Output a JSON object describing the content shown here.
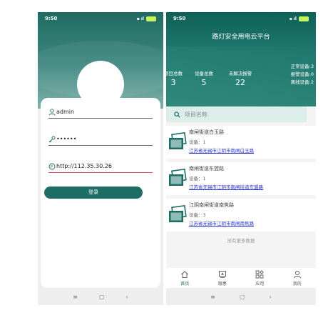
{
  "login": {
    "status": {
      "time": "9:50",
      "signal": "☰ ᵢₗₗ",
      "battery": "■"
    },
    "fields": {
      "username": "admin",
      "password": "••••••",
      "server": "http://112.35.30.26"
    },
    "login_button": "登录",
    "nav": {
      "menu": "≡",
      "home": "▢",
      "back": "‹"
    }
  },
  "app": {
    "status": {
      "time": "9:50",
      "signal": "☰ ᵢₗₗ",
      "battery": "■"
    },
    "title": "路灯安全用电云平台",
    "stats": [
      {
        "label": "项目总数",
        "value": "3"
      },
      {
        "label": "设备总数",
        "value": "5"
      },
      {
        "label": "未解决报警",
        "value": "22"
      }
    ],
    "side_stats": [
      "正常设备:3",
      "报警设备:0",
      "离线设备:2"
    ],
    "search_placeholder": "项目名称",
    "projects": [
      {
        "name": "南闸街道白玉路",
        "count": "设备：1",
        "address": "江苏省无锡市江阴市南闸白玉路"
      },
      {
        "name": "南闸街道东盟路",
        "count": "设备：1",
        "address": "江苏省无锡市江阴市南闸街道东盟路"
      },
      {
        "name": "江阴南闸街道南焦路",
        "count": "设备：3",
        "address": "江苏省无锡市江阴市南闸南焦路"
      }
    ],
    "no_more": "没有更多数据",
    "tabs": [
      {
        "label": "首页",
        "icon": "home-icon"
      },
      {
        "label": "隐患",
        "icon": "monitor-icon"
      },
      {
        "label": "应用",
        "icon": "apps-icon"
      },
      {
        "label": "我的",
        "icon": "user-icon"
      }
    ],
    "nav": {
      "menu": "≡",
      "home": "▢",
      "back": "‹"
    },
    "accent": "#1d6d64",
    "link_color": "#2b36c9"
  }
}
